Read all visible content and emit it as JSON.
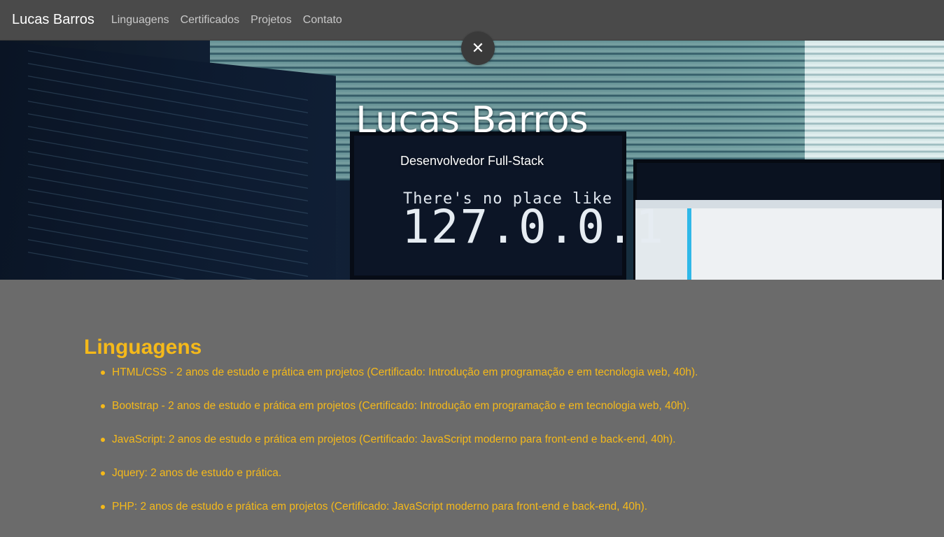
{
  "navbar": {
    "brand": "Lucas Barros",
    "links": [
      "Linguagens",
      "Certificados",
      "Projetos",
      "Contato"
    ]
  },
  "hero": {
    "title": "Lucas Barros",
    "subtitle": "Desenvolvedor Full-Stack",
    "screen_text_1": "There's no place like",
    "screen_text_2": "127.0.0.1"
  },
  "close_button": {
    "icon": "close-icon",
    "symbol": "✕"
  },
  "section": {
    "title": "Linguagens",
    "items": [
      "HTML/CSS - 2 anos de estudo e prática em projetos (Certificado: Introdução em programação e em tecnologia web, 40h).",
      "Bootstrap - 2 anos de estudo e prática em projetos (Certificado: Introdução em programação e em tecnologia web, 40h).",
      "JavaScript: 2 anos de estudo e prática em projetos (Certificado: JavaScript moderno para front-end e back-end, 40h).",
      "Jquery: 2 anos de estudo e prática.",
      "PHP: 2 anos de estudo e prática em projetos (Certificado: JavaScript moderno para front-end e back-end, 40h)."
    ]
  },
  "colors": {
    "accent": "#f5b91a",
    "navbar_bg": "#4a4a4a",
    "page_bg": "#6b6b6b"
  }
}
